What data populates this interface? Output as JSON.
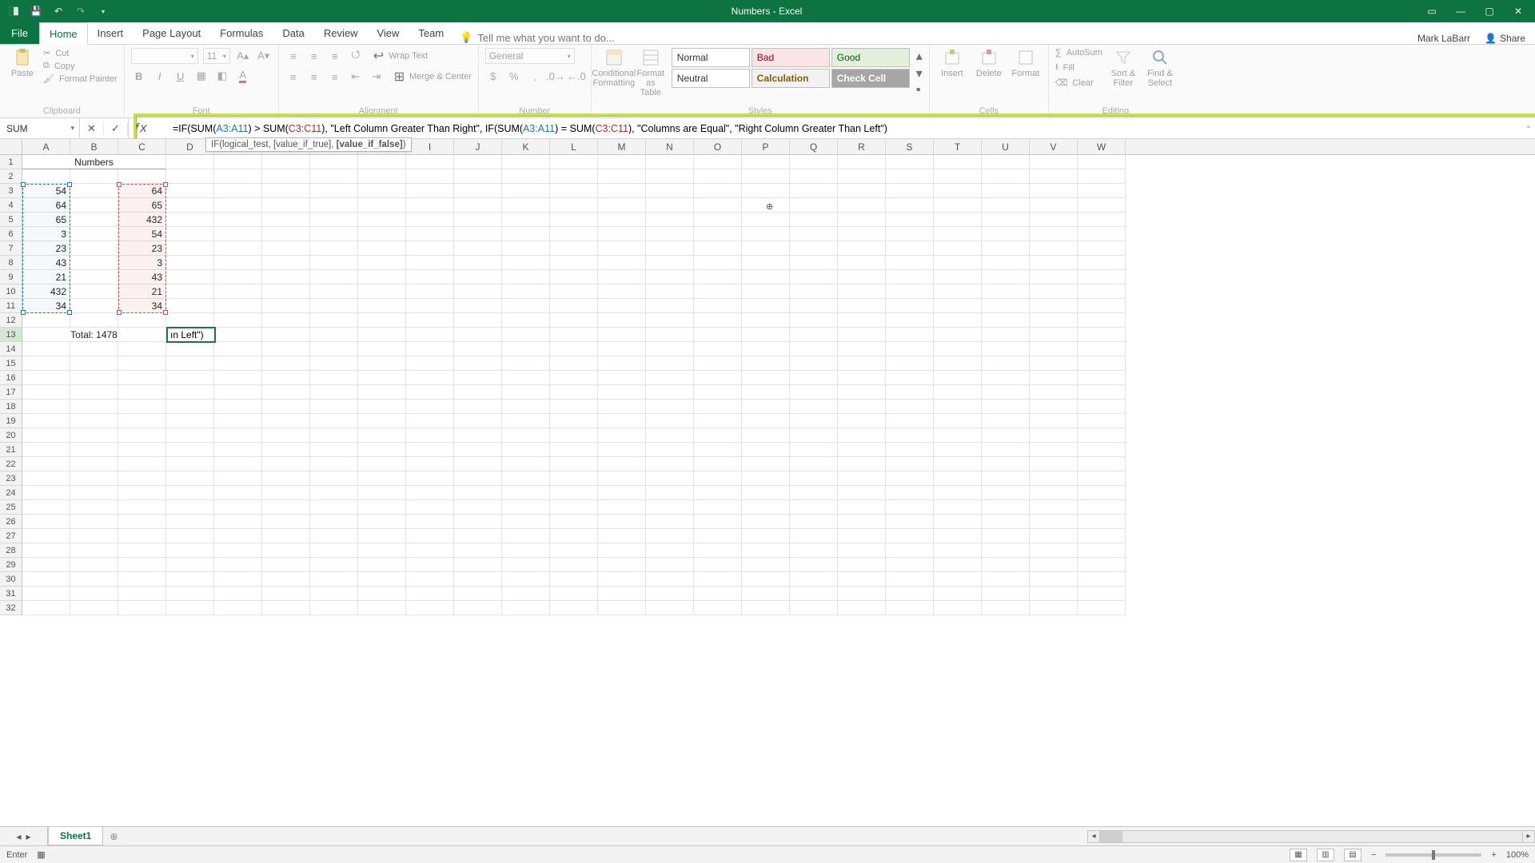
{
  "app": {
    "title": "Numbers - Excel"
  },
  "titlebar_icons": {
    "save": "save-icon",
    "undo": "undo-icon",
    "redo": "redo-icon",
    "customize": "customize-qat-icon",
    "displayopts": "ribbon-display-options-icon",
    "min": "minimize-icon",
    "max": "maximize-icon",
    "close": "close-icon"
  },
  "tabs": {
    "file": "File",
    "items": [
      "Home",
      "Insert",
      "Page Layout",
      "Formulas",
      "Data",
      "Review",
      "View",
      "Team"
    ],
    "active": "Home",
    "tell_me_placeholder": "Tell me what you want to do..."
  },
  "user": {
    "name": "Mark LaBarr",
    "share": "Share"
  },
  "ribbon": {
    "clipboard": {
      "paste": "Paste",
      "cut": "Cut",
      "copy": "Copy",
      "format_painter": "Format Painter",
      "label": "Clipboard"
    },
    "font": {
      "name_placeholder": "",
      "size": "11",
      "label": "Font"
    },
    "alignment": {
      "wrap": "Wrap Text",
      "merge": "Merge & Center",
      "label": "Alignment"
    },
    "number": {
      "format": "General",
      "label": "Number"
    },
    "styles": {
      "cond": "Conditional Formatting",
      "format_as": "Format as Table",
      "gallery": [
        "Normal",
        "Bad",
        "Good",
        "Neutral",
        "Calculation",
        "Check Cell"
      ],
      "label": "Styles"
    },
    "cells": {
      "insert": "Insert",
      "delete": "Delete",
      "format": "Format",
      "label": "Cells"
    },
    "editing": {
      "autosum": "AutoSum",
      "fill": "Fill",
      "clear": "Clear",
      "sort": "Sort & Filter",
      "find": "Find & Select",
      "label": "Editing"
    }
  },
  "namebox": {
    "value": "SUM"
  },
  "formula_bar": {
    "prefix1": "=IF(SUM(",
    "ref1a": "A3:A11",
    "mid1": ") > SUM(",
    "ref1b": "C3:C11",
    "mid2": "), \"Left Column Greater Than Right\", IF(SUM(",
    "ref2a": "A3:A11",
    "mid3": ") = SUM(",
    "ref2b": "C3:C11",
    "suffix": "), \"Columns are Equal\", \"Right Column Greater Than Left\")"
  },
  "syntax_tip": {
    "text_pre": "IF(logical_test, [value_if_true], ",
    "bold": "[value_if_false]",
    "text_post": ")"
  },
  "columns": [
    "A",
    "B",
    "C",
    "D",
    "E",
    "F",
    "G",
    "H",
    "I",
    "J",
    "K",
    "L",
    "M",
    "N",
    "O",
    "P",
    "Q",
    "R",
    "S",
    "T",
    "U",
    "V",
    "W"
  ],
  "rows_visible": 32,
  "sheet": {
    "header_merged": "Numbers",
    "col_a": [
      "54",
      "64",
      "65",
      "3",
      "23",
      "43",
      "21",
      "432",
      "34"
    ],
    "col_c": [
      "64",
      "65",
      "432",
      "54",
      "23",
      "3",
      "43",
      "21",
      "34"
    ],
    "total_label": "Total: 1478",
    "editing_cell_display": "ın Left\")"
  },
  "sheettabs": {
    "active": "Sheet1"
  },
  "statusbar": {
    "mode": "Enter",
    "zoom": "100%"
  }
}
